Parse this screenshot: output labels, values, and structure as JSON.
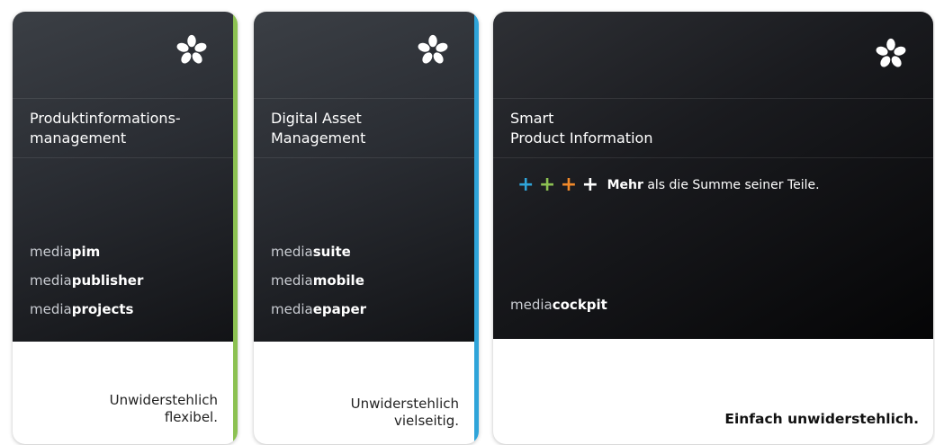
{
  "cards": [
    {
      "title": "Produktinformations-\nmanagement",
      "products": [
        {
          "prefix": "media",
          "suffix": "pim"
        },
        {
          "prefix": "media",
          "suffix": "publisher"
        },
        {
          "prefix": "media",
          "suffix": "projects"
        }
      ],
      "tagline": "Unwiderstehlich\nflexibel.",
      "accent_color": "#8cc152"
    },
    {
      "title": "Digital Asset\nManagement",
      "products": [
        {
          "prefix": "media",
          "suffix": "suite"
        },
        {
          "prefix": "media",
          "suffix": "mobile"
        },
        {
          "prefix": "media",
          "suffix": "epaper"
        }
      ],
      "tagline": "Unwiderstehlich\nvielseitig.",
      "accent_color": "#2fa4d9"
    },
    {
      "title": "Smart\nProduct Information",
      "slogan_bold": "Mehr",
      "slogan_rest": " als die Summe seiner Teile.",
      "plus_colors": [
        "#2fa4d9",
        "#8cc152",
        "#f0892a",
        "#ffffff"
      ],
      "plus_glyph": "+",
      "products": [
        {
          "prefix": "media",
          "suffix": "cockpit"
        }
      ],
      "tagline": "Einfach unwiderstehlich."
    }
  ],
  "icons": {
    "logo": "flower-logo-icon"
  }
}
